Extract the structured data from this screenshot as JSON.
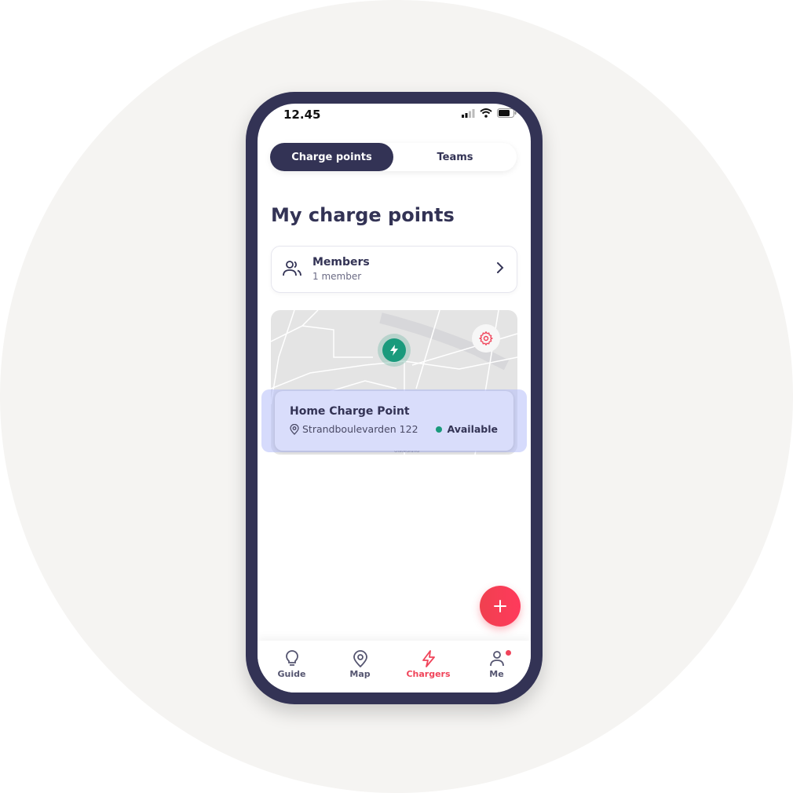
{
  "status_bar": {
    "time": "12.45"
  },
  "segmented": {
    "tabs": [
      {
        "label": "Charge points",
        "active": true
      },
      {
        "label": "Teams",
        "active": false
      }
    ]
  },
  "page": {
    "title": "My charge points"
  },
  "members": {
    "label": "Members",
    "count_text": "1 member"
  },
  "map": {
    "street_label": "Ulstedlund"
  },
  "charge_point": {
    "name": "Home Charge Point",
    "address": "Strandboulevarden 122",
    "status": "Available",
    "status_color": "#1a9a7c"
  },
  "tabbar": {
    "items": [
      {
        "label": "Guide",
        "icon": "lightbulb-icon",
        "active": false
      },
      {
        "label": "Map",
        "icon": "map-pin-icon",
        "active": false
      },
      {
        "label": "Chargers",
        "icon": "lightning-icon",
        "active": true
      },
      {
        "label": "Me",
        "icon": "user-icon",
        "active": false,
        "badge": true
      }
    ]
  },
  "colors": {
    "primary": "#333355",
    "accent": "#f0445a",
    "success": "#1a9a7c"
  }
}
